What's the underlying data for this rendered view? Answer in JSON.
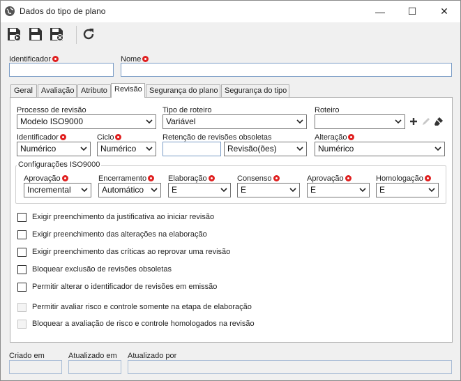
{
  "window": {
    "title": "Dados do tipo de plano",
    "minimize": "—",
    "maximize": "☐",
    "close": "✕"
  },
  "toolbar": {
    "icons": [
      "save-new-icon",
      "save-icon",
      "save-close-icon",
      "refresh-icon"
    ]
  },
  "header": {
    "identificador_label": "Identificador",
    "identificador_value": "",
    "nome_label": "Nome",
    "nome_value": ""
  },
  "tabs": [
    "Geral",
    "Avaliação",
    "Atributo",
    "Revisão",
    "Segurança do plano",
    "Segurança do tipo"
  ],
  "active_tab": "Revisão",
  "revisao": {
    "processo_label": "Processo de revisão",
    "processo_value": "Modelo ISO9000",
    "tipo_roteiro_label": "Tipo de roteiro",
    "tipo_roteiro_value": "Variável",
    "roteiro_label": "Roteiro",
    "roteiro_value": "",
    "identificador_label": "Identificador",
    "identificador_value": "Numérico",
    "ciclo_label": "Ciclo",
    "ciclo_value": "Numérico",
    "retencao_label": "Retenção de revisões obsoletas",
    "retencao_number": "",
    "retencao_unit": "Revisão(ões)",
    "alteracao_label": "Alteração",
    "alteracao_value": "Numérico"
  },
  "iso": {
    "group_title": "Configurações ISO9000",
    "aprovacao_label": "Aprovação",
    "aprovacao_value": "Incremental",
    "encerramento_label": "Encerramento",
    "encerramento_value": "Automático",
    "elaboracao_label": "Elaboração",
    "elaboracao_value": "E",
    "consenso_label": "Consenso",
    "consenso_value": "E",
    "aprovacao2_label": "Aprovação",
    "aprovacao2_value": "E",
    "homologacao_label": "Homologação",
    "homologacao_value": "E"
  },
  "checkboxes": [
    {
      "label": "Exigir preenchimento da justificativa ao iniciar revisão",
      "checked": false,
      "enabled": true
    },
    {
      "label": "Exigir preenchimento das alterações na elaboração",
      "checked": false,
      "enabled": true
    },
    {
      "label": "Exigir preenchimento das críticas ao reprovar uma revisão",
      "checked": false,
      "enabled": true
    },
    {
      "label": "Bloquear exclusão de revisões obsoletas",
      "checked": false,
      "enabled": true
    },
    {
      "label": "Permitir alterar o identificador de revisões em emissão",
      "checked": false,
      "enabled": true
    },
    {
      "label": "Permitir avaliar risco e controle somente na etapa de elaboração",
      "checked": false,
      "enabled": false
    },
    {
      "label": "Bloquear a avaliação de risco e controle homologados na revisão",
      "checked": false,
      "enabled": false
    }
  ],
  "footer": {
    "criado_label": "Criado em",
    "criado_value": "",
    "atualizado_label": "Atualizado em",
    "atualizado_value": "",
    "atualizado_por_label": "Atualizado por",
    "atualizado_por_value": ""
  },
  "colors": {
    "required": "#e02020",
    "input_border": "#7a9cc6",
    "select_border": "#767676",
    "background": "#f0f0f0"
  }
}
